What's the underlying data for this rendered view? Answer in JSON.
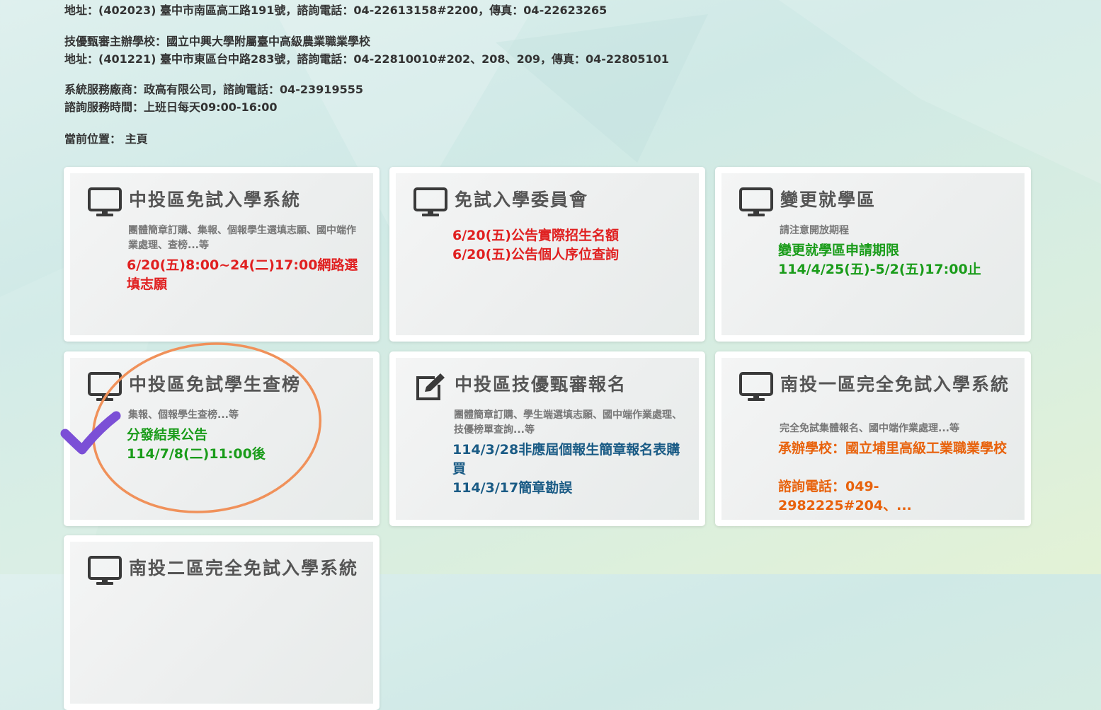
{
  "header": {
    "line1": "地址：(402023) 臺中市南區高工路191號，諮詢電話：04-22613158#2200，傳真：04-22623265",
    "line2": "技優甄審主辦學校：國立中興大學附屬臺中高級農業職業學校",
    "line3": "地址：(401221) 臺中市東區台中路283號，諮詢電話：04-22810010#202、208、209，傳真：04-22805101",
    "line4": "系統服務廠商：政高有限公司，諮詢電話：04-23919555",
    "line5": "諮詢服務時間：上班日每天09:00-16:00",
    "breadcrumb": "當前位置： 主頁"
  },
  "cards": [
    {
      "icon": "monitor-icon",
      "title": "中投區免試入學系統",
      "desc": "團體簡章訂購、集報、個報學生選填志願、國中端作業處理、查榜...等",
      "note": "6/20(五)8:00~24(二)17:00網路選填志願",
      "note_color": "#e02020"
    },
    {
      "icon": "monitor-icon",
      "title": "免試入學委員會",
      "note_lines": [
        "6/20(五)公告實際招生名額",
        "6/20(五)公告個人序位查詢"
      ],
      "note_color": "#e02020"
    },
    {
      "icon": "monitor-icon",
      "title": "變更就學區",
      "desc": "請注意開放期程",
      "note_lines": [
        "變更就學區申請期限",
        "114/4/25(五)-5/2(五)17:00止"
      ],
      "note_color": "#1a9c1a"
    },
    {
      "icon": "monitor-icon",
      "title": "中投區免試學生查榜",
      "desc": "集報、個報學生查榜...等",
      "note_lines": [
        "分發結果公告",
        "114/7/8(二)11:00後"
      ],
      "note_color": "#1a9c1a"
    },
    {
      "icon": "edit-icon",
      "title": "中投區技優甄審報名",
      "desc": "團體簡章訂購、學生端選填志願、國中端作業處理、技優榜單查詢...等",
      "note_lines": [
        "114/3/28非應屆個報生簡章報名表購買",
        "114/3/17簡章勘誤"
      ],
      "note_color": "#1a5b85"
    },
    {
      "icon": "monitor-icon",
      "title": "南投一區完全免試入學系統",
      "desc": "完全免試集體報名、國中端作業處理...等",
      "note_lines": [
        "承辦學校：國立埔里高級工業職業學校",
        "諮詢電話：049-2982225#204、..."
      ],
      "note_color": "#e8620c"
    },
    {
      "icon": "monitor-icon",
      "title": "南投二區完全免試入學系統"
    }
  ],
  "annotation": {
    "check_color": "#7b4fd6",
    "circle_color": "#f0915a"
  }
}
